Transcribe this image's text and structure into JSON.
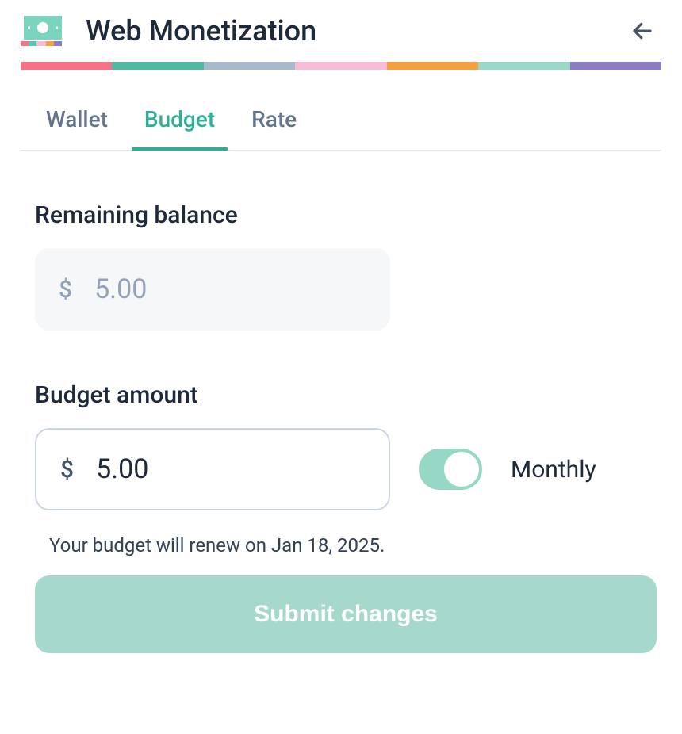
{
  "header": {
    "title": "Web Monetization"
  },
  "tabs": [
    {
      "id": "wallet",
      "label": "Wallet",
      "active": false
    },
    {
      "id": "budget",
      "label": "Budget",
      "active": true
    },
    {
      "id": "rate",
      "label": "Rate",
      "active": false
    }
  ],
  "remaining_balance": {
    "label": "Remaining balance",
    "currency_symbol": "$",
    "value": "5.00"
  },
  "budget_amount": {
    "label": "Budget amount",
    "currency_symbol": "$",
    "value": "5.00",
    "recurring_label": "Monthly",
    "recurring_on": true
  },
  "renewal_note": "Your budget will renew on Jan 18, 2025.",
  "submit_label": "Submit changes"
}
